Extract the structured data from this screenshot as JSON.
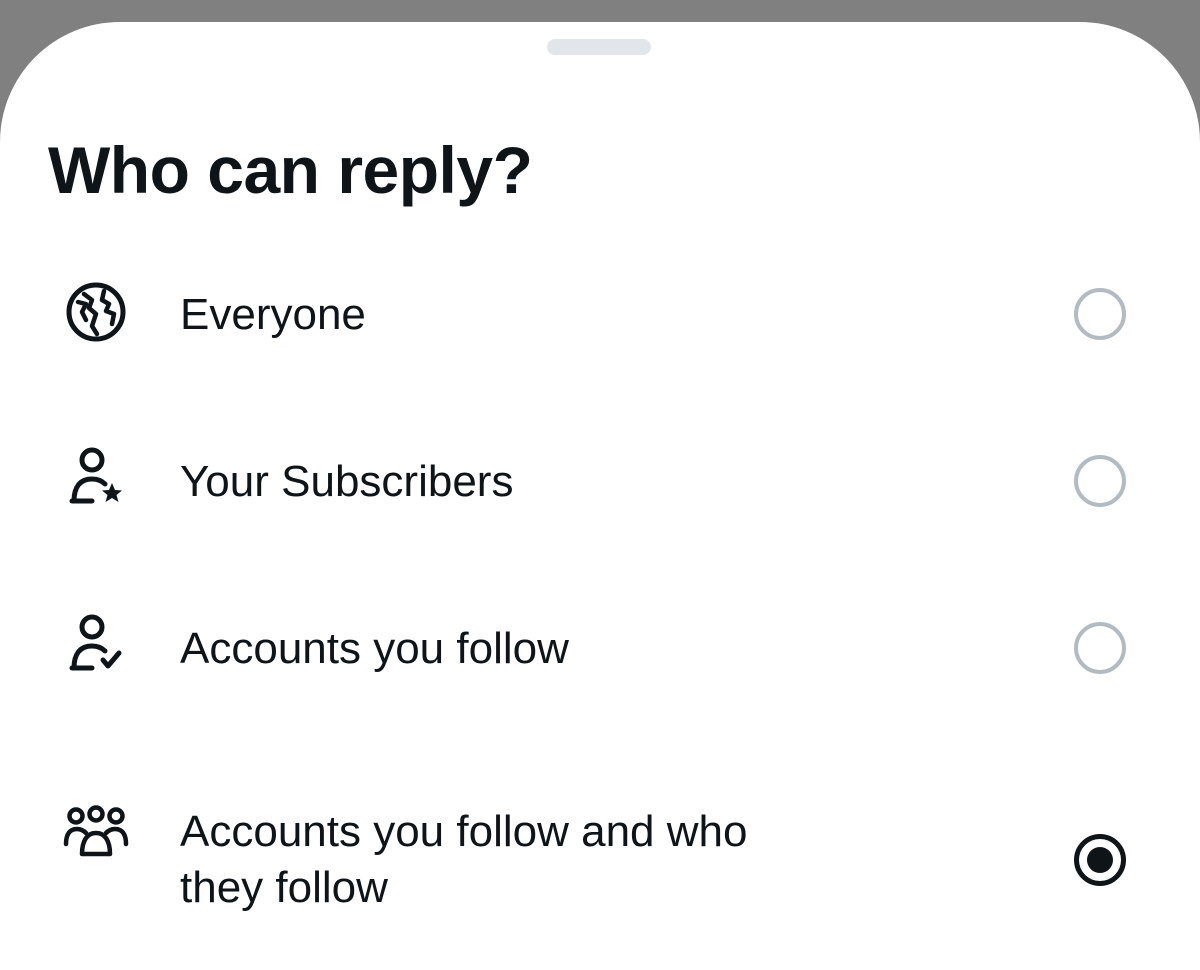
{
  "sheet": {
    "title": "Who can reply?"
  },
  "options": [
    {
      "label": "Everyone",
      "icon": "globe-icon",
      "selected": false
    },
    {
      "label": "Your Subscribers",
      "icon": "person-star-icon",
      "selected": false
    },
    {
      "label": "Accounts you follow",
      "icon": "person-check-icon",
      "selected": false
    },
    {
      "label": "Accounts you follow and who\nthey follow",
      "icon": "people-group-icon",
      "selected": true
    }
  ],
  "colors": {
    "text": "#0f1419",
    "radio_unselected": "#b3bbc2",
    "radio_selected": "#0f1419",
    "overlay": "#808080",
    "grabber": "#e2e6ea"
  }
}
